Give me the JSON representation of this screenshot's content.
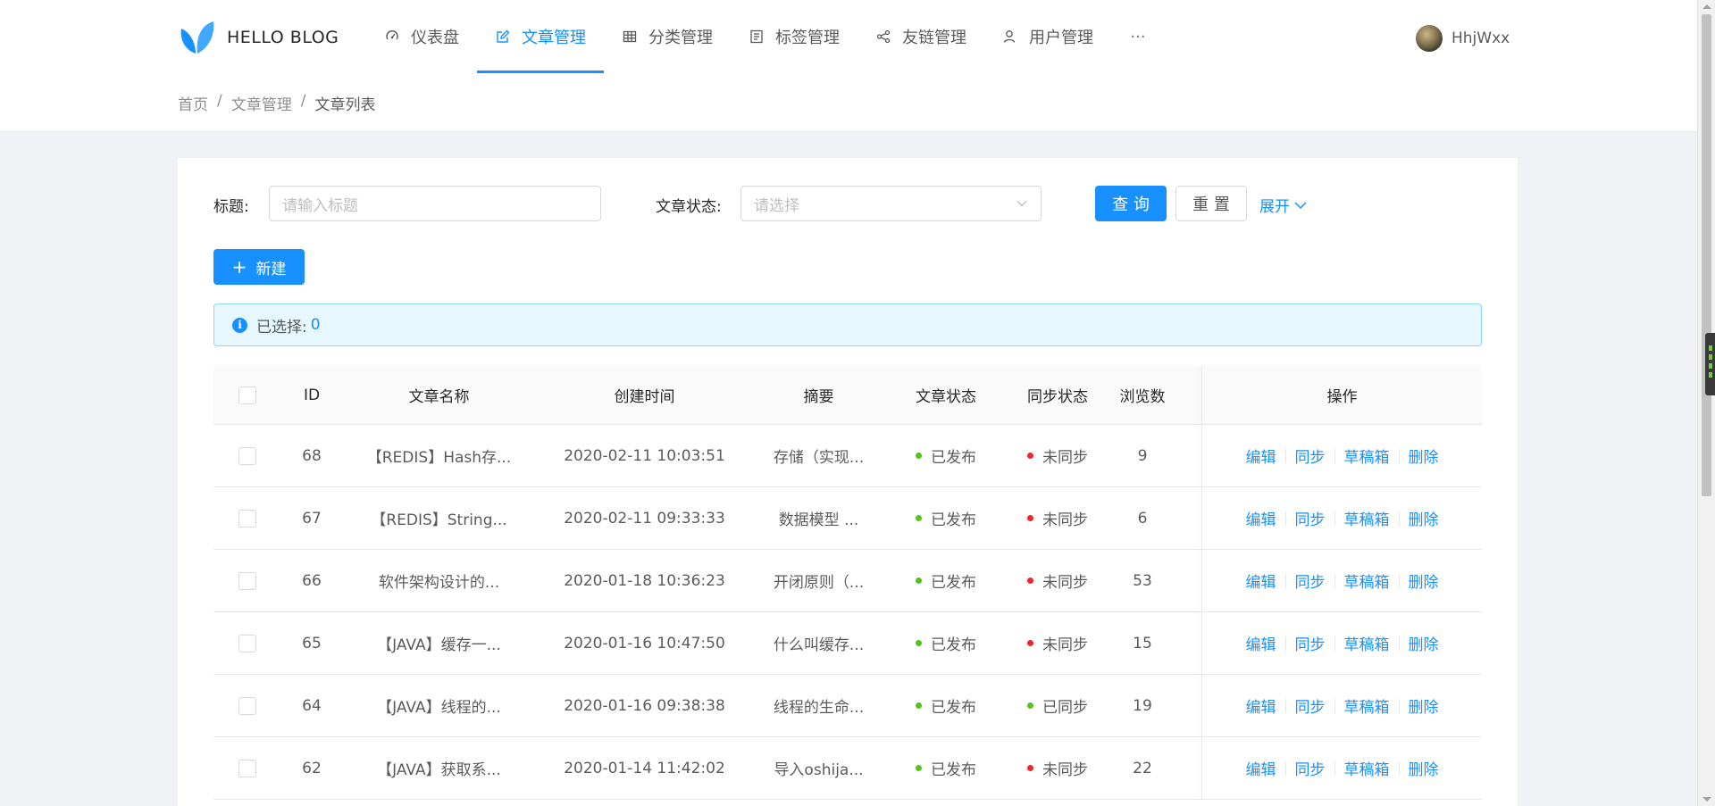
{
  "header": {
    "logo_text": "HELLO BLOG",
    "nav": [
      {
        "label": "仪表盘",
        "icon": "dashboard-icon",
        "active": false
      },
      {
        "label": "文章管理",
        "icon": "edit-icon",
        "active": true
      },
      {
        "label": "分类管理",
        "icon": "table-icon",
        "active": false
      },
      {
        "label": "标签管理",
        "icon": "profile-icon",
        "active": false
      },
      {
        "label": "友链管理",
        "icon": "share-icon",
        "active": false
      },
      {
        "label": "用户管理",
        "icon": "user-icon",
        "active": false
      }
    ],
    "more_label": "···",
    "user_name": "HhjWxx"
  },
  "breadcrumb": [
    "首页",
    "文章管理",
    "文章列表"
  ],
  "breadcrumb_sep": "/",
  "search": {
    "title_label": "标题:",
    "title_placeholder": "请输入标题",
    "status_label": "文章状态:",
    "status_placeholder": "请选择",
    "query_label": "查 询",
    "reset_label": "重 置",
    "expand_label": "展开"
  },
  "new_button_label": "新建",
  "alert": {
    "label": "已选择:",
    "count": "0"
  },
  "table": {
    "headers": {
      "id": "ID",
      "name": "文章名称",
      "time": "创建时间",
      "summary": "摘要",
      "status": "文章状态",
      "sync": "同步状态",
      "views": "浏览数",
      "ops": "操作"
    },
    "op_labels": {
      "edit": "编辑",
      "sync": "同步",
      "draft": "草稿箱",
      "delete": "删除"
    },
    "rows": [
      {
        "id": "68",
        "name": "【REDIS】Hash存...",
        "time": "2020-02-11 10:03:51",
        "summary": "存储（实现...",
        "status": "已发布",
        "sync": "未同步",
        "views": "9"
      },
      {
        "id": "67",
        "name": "【REDIS】String...",
        "time": "2020-02-11 09:33:33",
        "summary": "数据模型 ...",
        "status": "已发布",
        "sync": "未同步",
        "views": "6"
      },
      {
        "id": "66",
        "name": "软件架构设计的...",
        "time": "2020-01-18 10:36:23",
        "summary": "开闭原则（...",
        "status": "已发布",
        "sync": "未同步",
        "views": "53"
      },
      {
        "id": "65",
        "name": "【JAVA】缓存一...",
        "time": "2020-01-16 10:47:50",
        "summary": "什么叫缓存...",
        "status": "已发布",
        "sync": "未同步",
        "views": "15"
      },
      {
        "id": "64",
        "name": "【JAVA】线程的...",
        "time": "2020-01-16 09:38:38",
        "summary": "线程的生命...",
        "status": "已发布",
        "sync": "已同步",
        "views": "19"
      },
      {
        "id": "62",
        "name": "【JAVA】获取系...",
        "time": "2020-01-14 11:42:02",
        "summary": "导入oshija...",
        "status": "已发布",
        "sync": "未同步",
        "views": "22"
      }
    ]
  },
  "colors": {
    "primary": "#1890ff",
    "success": "#52c41a",
    "error": "#f5222d"
  }
}
